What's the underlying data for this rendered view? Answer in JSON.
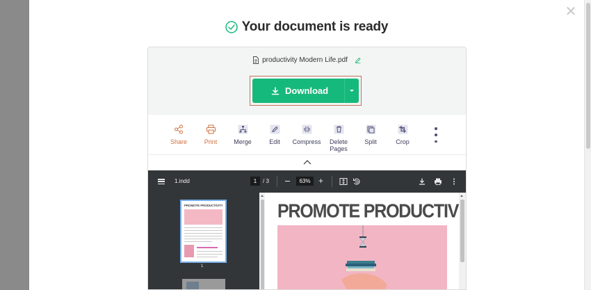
{
  "header": {
    "title": "Your document is ready"
  },
  "file": {
    "name": "productivity Modern Life.pdf"
  },
  "download": {
    "label": "Download"
  },
  "tools": [
    {
      "label": "Share",
      "icon": "share-icon"
    },
    {
      "label": "Print",
      "icon": "printer-icon"
    },
    {
      "label": "Merge",
      "icon": "merge-icon"
    },
    {
      "label": "Edit",
      "icon": "edit-icon"
    },
    {
      "label": "Compress",
      "icon": "compress-icon"
    },
    {
      "label": "Delete Pages",
      "icon": "trash-icon"
    },
    {
      "label": "Split",
      "icon": "split-icon"
    },
    {
      "label": "Crop",
      "icon": "crop-icon"
    }
  ],
  "viewer": {
    "doc_name": "1.indd",
    "page_current": "1",
    "page_total": "/ 3",
    "zoom": "63%",
    "thumb_label": "1",
    "thumb_title": "PROMOTE PRODUCTIVITY",
    "page_title": "PROMOTE PRODUCTIVITY"
  },
  "colors": {
    "accent": "#16b97c",
    "orange": "#d0703f",
    "tool_text": "#3d3d5c",
    "viewer_bar": "#323639"
  }
}
